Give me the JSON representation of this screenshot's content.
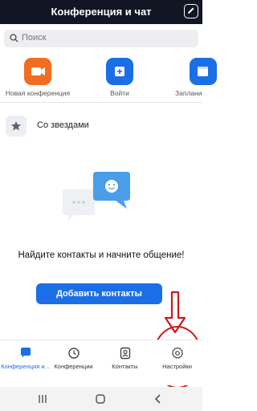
{
  "header": {
    "title": "Конференция и чат",
    "edit_icon": "edit-icon"
  },
  "search": {
    "placeholder": "Поиск",
    "icon": "search-icon"
  },
  "actions": [
    {
      "label": "Новая конференция",
      "icon": "video-camera-icon",
      "color": "#f26d21"
    },
    {
      "label": "Войти",
      "icon": "plus-icon",
      "color": "#1a6fe6"
    },
    {
      "label": "Заплани",
      "icon": "calendar-icon",
      "color": "#1a6fe6"
    }
  ],
  "starred": {
    "label": "Со звездами",
    "icon": "star-icon"
  },
  "empty_state": {
    "message": "Найдите контакты и начните общение!",
    "button_label": "Добавить контакты"
  },
  "tabs": [
    {
      "label": "Конференция и...",
      "icon": "chat-bubble-icon",
      "active": true
    },
    {
      "label": "Конференции",
      "icon": "clock-icon",
      "active": false
    },
    {
      "label": "Контакты",
      "icon": "contact-card-icon",
      "active": false
    },
    {
      "label": "Настройки",
      "icon": "gear-icon",
      "active": false
    }
  ],
  "colors": {
    "accent": "#1a6fe6",
    "header_bg": "#121524",
    "annotation": "#cc1a1a"
  }
}
